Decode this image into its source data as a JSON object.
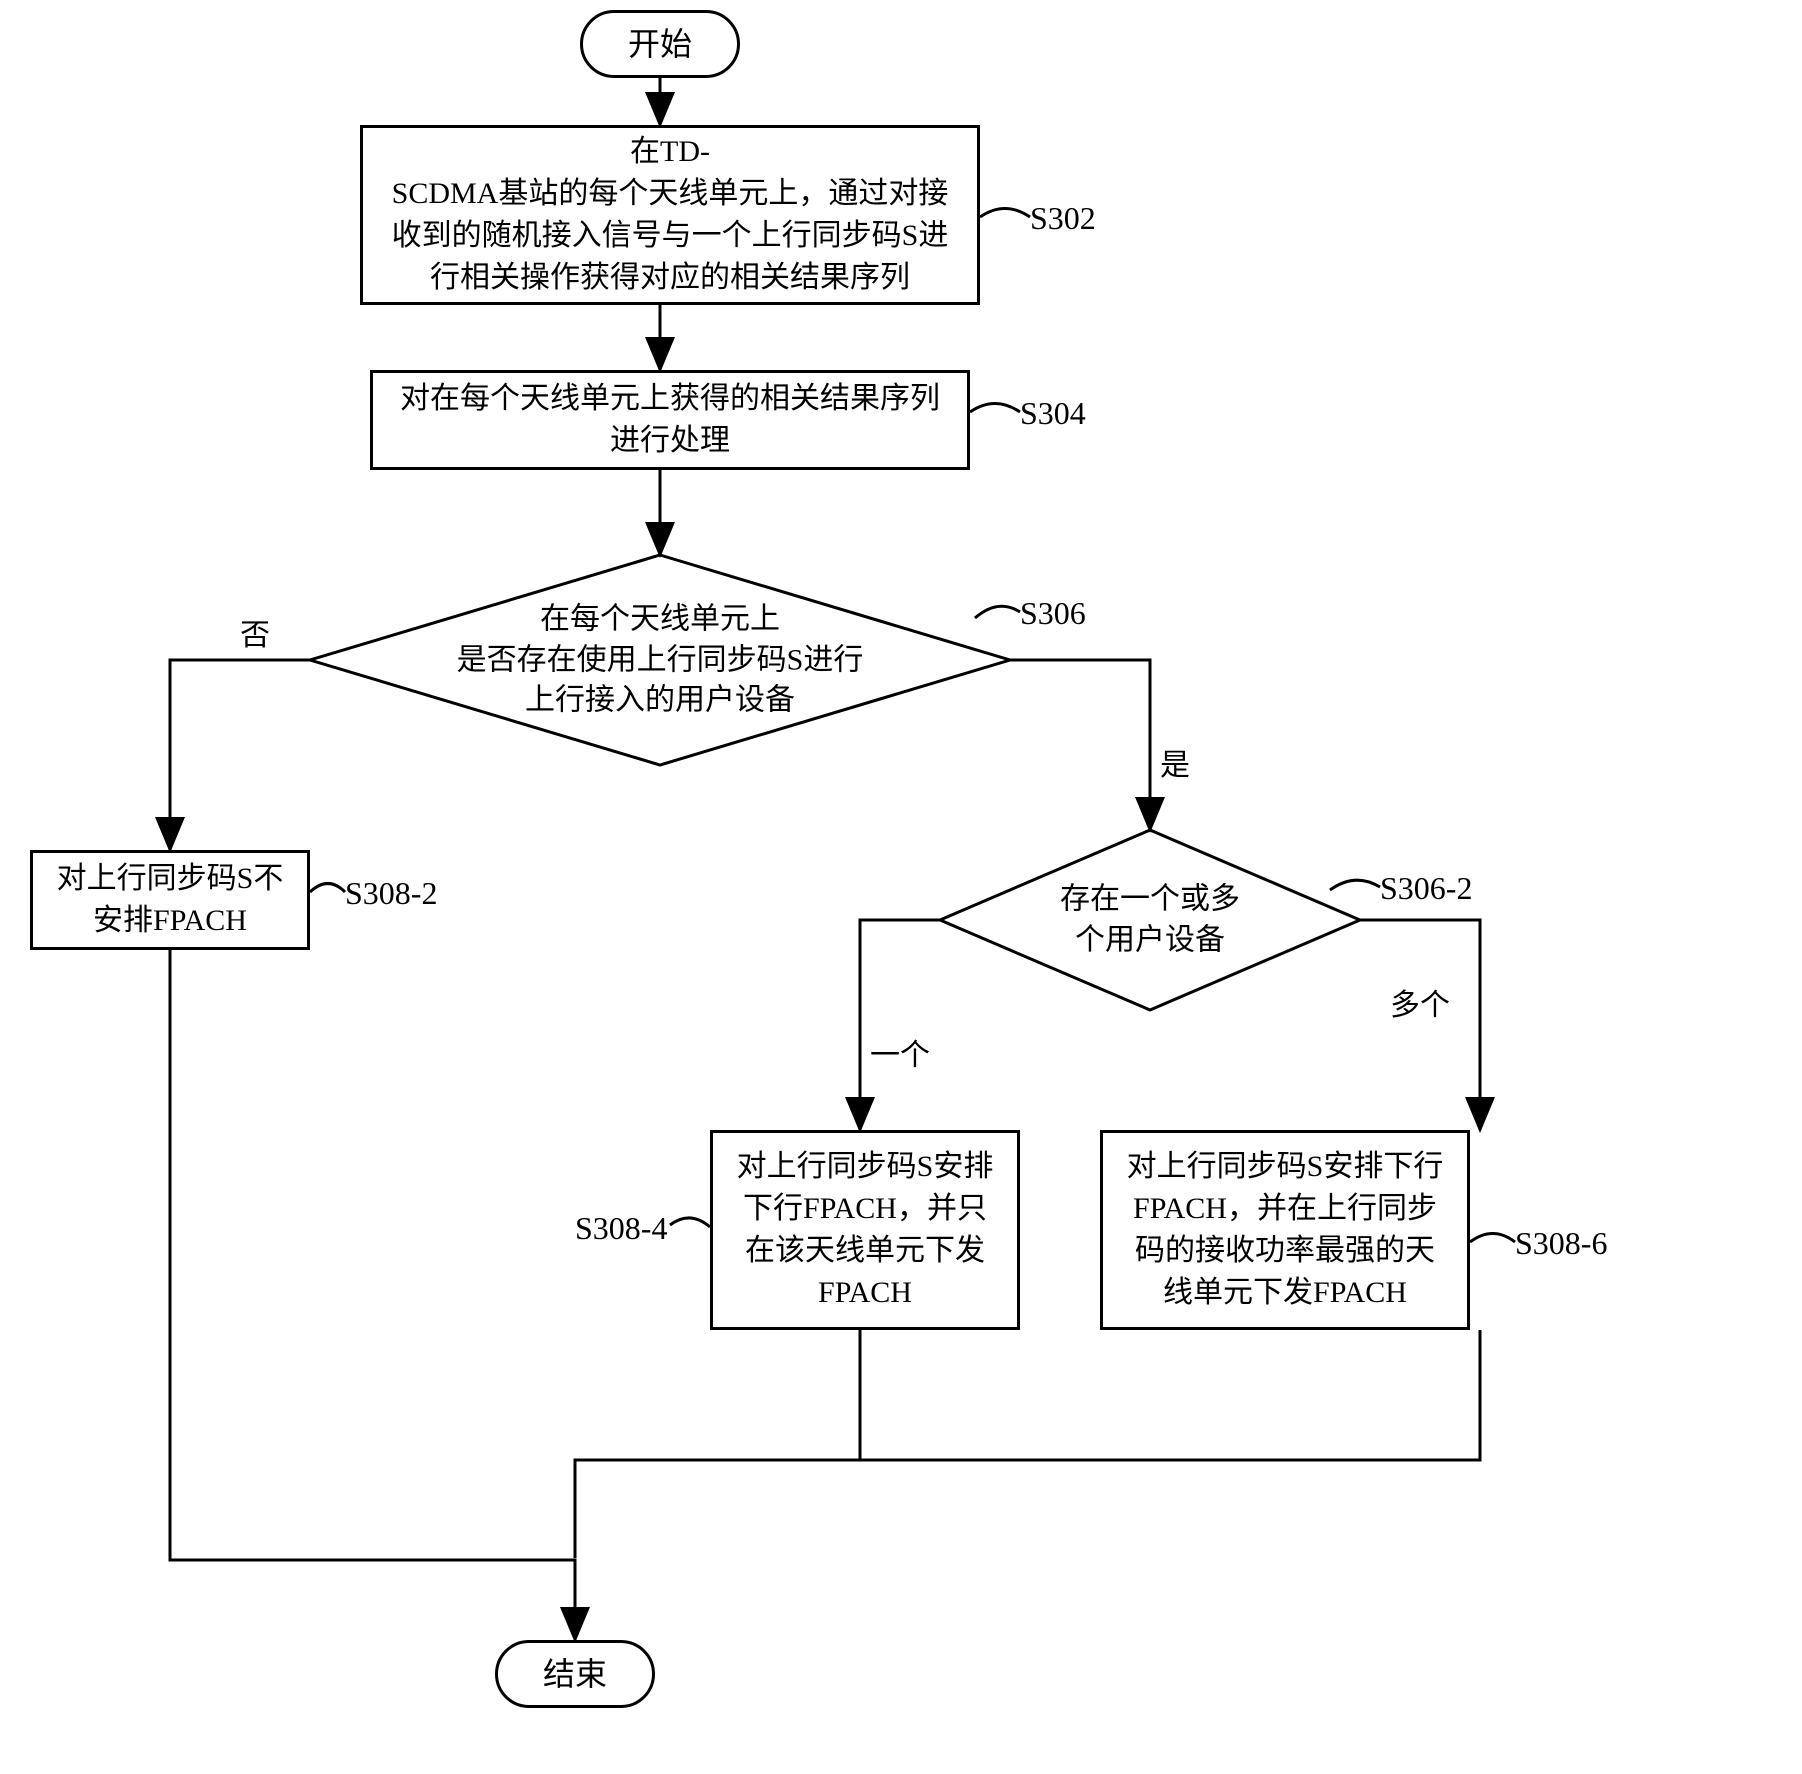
{
  "chart_data": {
    "type": "flowchart",
    "nodes": [
      {
        "id": "start",
        "type": "terminator",
        "text": "开始"
      },
      {
        "id": "s302",
        "type": "process",
        "text": "在TD-\nSCDMA基站的每个天线单元上，通过对接\n收到的随机接入信号与一个上行同步码S进\n行相关操作获得对应的相关结果序列",
        "tag": "S302"
      },
      {
        "id": "s304",
        "type": "process",
        "text": "对在每个天线单元上获得的相关结果序列\n进行处理",
        "tag": "S304"
      },
      {
        "id": "s306",
        "type": "decision",
        "text": "在每个天线单元上\n是否存在使用上行同步码S进行\n上行接入的用户设备",
        "tag": "S306"
      },
      {
        "id": "s306-2",
        "type": "decision",
        "text": "存在一个或多\n个用户设备",
        "tag": "S306-2"
      },
      {
        "id": "s308-2",
        "type": "process",
        "text": "对上行同步码S不\n安排FPACH",
        "tag": "S308-2"
      },
      {
        "id": "s308-4",
        "type": "process",
        "text": "对上行同步码S安排\n下行FPACH，并只\n在该天线单元下发\nFPACH",
        "tag": "S308-4"
      },
      {
        "id": "s308-6",
        "type": "process",
        "text": "对上行同步码S安排下行\nFPACH，并在上行同步\n码的接收功率最强的天\n线单元下发FPACH",
        "tag": "S308-6"
      },
      {
        "id": "end",
        "type": "terminator",
        "text": "结束"
      }
    ],
    "edges": [
      {
        "from": "start",
        "to": "s302"
      },
      {
        "from": "s302",
        "to": "s304"
      },
      {
        "from": "s304",
        "to": "s306"
      },
      {
        "from": "s306",
        "to": "s308-2",
        "label": "否"
      },
      {
        "from": "s306",
        "to": "s306-2",
        "label": "是"
      },
      {
        "from": "s306-2",
        "to": "s308-4",
        "label": "一个"
      },
      {
        "from": "s306-2",
        "to": "s308-6",
        "label": "多个"
      },
      {
        "from": "s308-2",
        "to": "end"
      },
      {
        "from": "s308-4",
        "to": "end"
      },
      {
        "from": "s308-6",
        "to": "end"
      }
    ]
  },
  "start": {
    "text": "开始"
  },
  "end": {
    "text": "结束"
  },
  "s302": {
    "line1": "在TD-",
    "line2": "SCDMA基站的每个天线单元上，通过对接",
    "line3": "收到的随机接入信号与一个上行同步码S进",
    "line4": "行相关操作获得对应的相关结果序列",
    "tag": "S302"
  },
  "s304": {
    "line1": "对在每个天线单元上获得的相关结果序列",
    "line2": "进行处理",
    "tag": "S304"
  },
  "s306": {
    "line1": "在每个天线单元上",
    "line2": "是否存在使用上行同步码S进行",
    "line3": "上行接入的用户设备",
    "tag": "S306"
  },
  "s306_2": {
    "line1": "存在一个或多",
    "line2": "个用户设备",
    "tag": "S306-2"
  },
  "s308_2": {
    "line1": "对上行同步码S不",
    "line2": "安排FPACH",
    "tag": "S308-2"
  },
  "s308_4": {
    "line1": "对上行同步码S安排",
    "line2": "下行FPACH，并只",
    "line3": "在该天线单元下发",
    "line4": "FPACH",
    "tag": "S308-4"
  },
  "s308_6": {
    "line1": "对上行同步码S安排下行",
    "line2": "FPACH，并在上行同步",
    "line3": "码的接收功率最强的天",
    "line4": "线单元下发FPACH",
    "tag": "S308-6"
  },
  "edge_labels": {
    "no": "否",
    "yes": "是",
    "one": "一个",
    "many": "多个"
  }
}
